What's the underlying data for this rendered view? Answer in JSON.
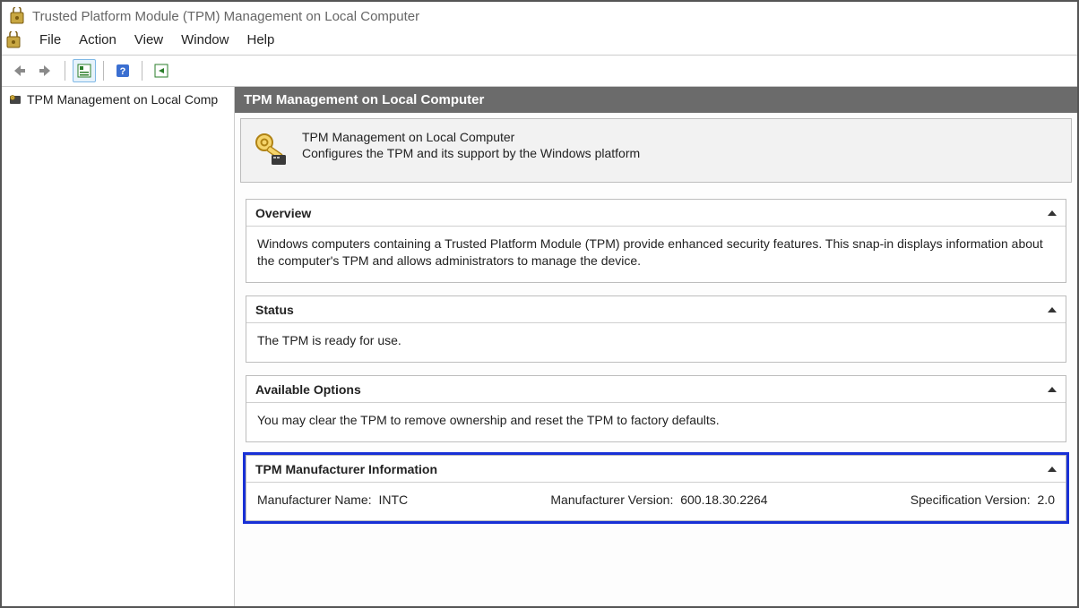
{
  "window": {
    "title": "Trusted Platform Module (TPM) Management on Local Computer"
  },
  "menu": {
    "items": [
      "File",
      "Action",
      "View",
      "Window",
      "Help"
    ]
  },
  "toolbar": {
    "back": "back-icon",
    "forward": "forward-icon",
    "props": "properties-icon",
    "help": "help-icon",
    "export": "export-icon"
  },
  "tree": {
    "root_label": "TPM Management on Local Comp"
  },
  "content": {
    "header": "TPM Management on Local Computer",
    "desc_title": "TPM Management on Local Computer",
    "desc_sub": "Configures the TPM and its support by the Windows platform",
    "panels": {
      "overview": {
        "title": "Overview",
        "text": "Windows computers containing a Trusted Platform Module (TPM) provide enhanced security features. This snap-in displays information about the computer's TPM and allows administrators to manage the device."
      },
      "status": {
        "title": "Status",
        "text": "The TPM is ready for use."
      },
      "options": {
        "title": "Available Options",
        "text": "You may clear the TPM to remove ownership and reset the TPM to factory defaults."
      },
      "manufacturer": {
        "title": "TPM Manufacturer Information",
        "name_label": "Manufacturer Name:",
        "name_value": "INTC",
        "version_label": "Manufacturer Version:",
        "version_value": "600.18.30.2264",
        "spec_label": "Specification Version:",
        "spec_value": "2.0"
      }
    }
  }
}
